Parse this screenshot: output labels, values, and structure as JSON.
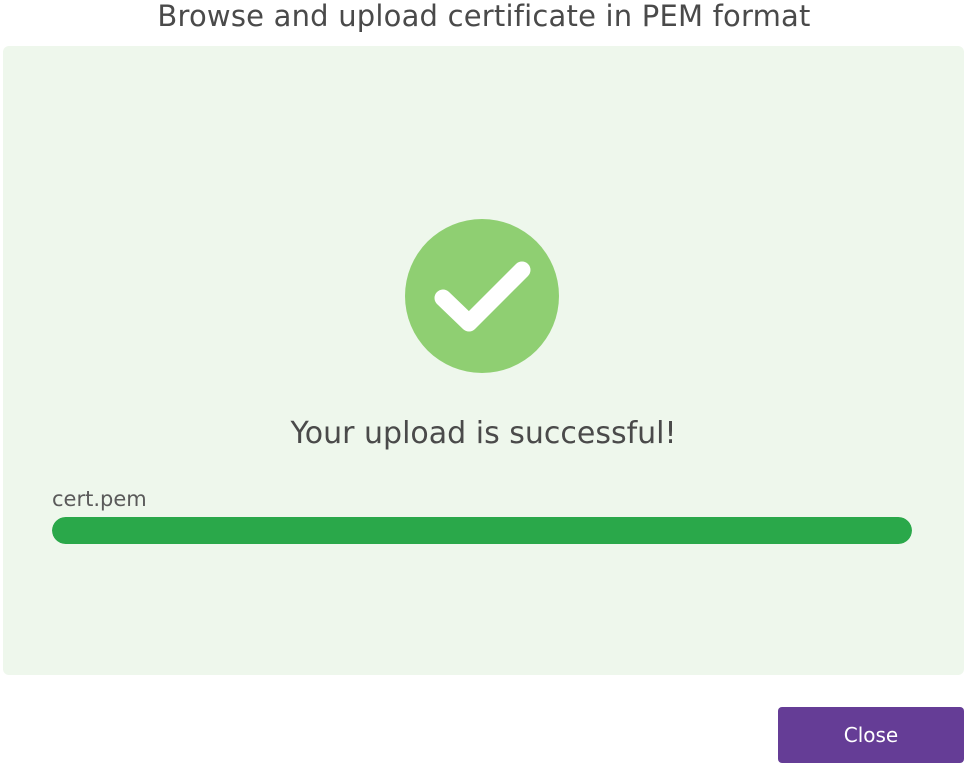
{
  "dialog": {
    "title": "Browse and upload certificate in PEM format"
  },
  "upload": {
    "status_icon": "check-circle-icon",
    "message": "Your upload is successful!",
    "file_name": "cert.pem",
    "progress_percent": 100
  },
  "footer": {
    "close_label": "Close"
  },
  "colors": {
    "panel_background": "#eef7ec",
    "success_icon": "#8fcf72",
    "progress_bar": "#2aa84a",
    "close_button": "#653d96",
    "text": "#4a4a4a"
  }
}
